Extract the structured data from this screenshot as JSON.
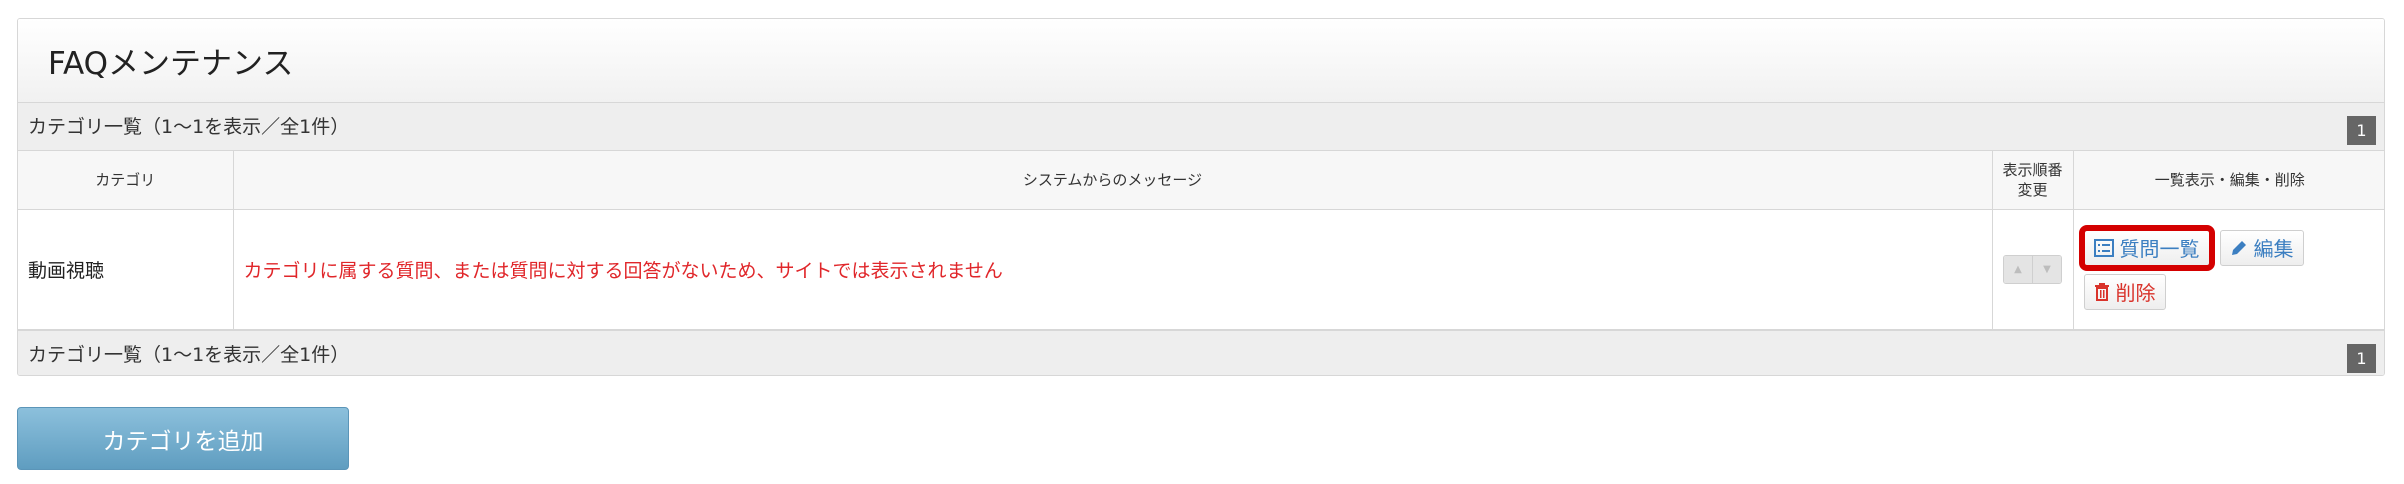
{
  "page": {
    "title": "FAQメンテナンス"
  },
  "pager": {
    "summary_top": "カテゴリ一覧（1〜1を表示／全1件）",
    "summary_bottom": "カテゴリ一覧（1〜1を表示／全1件）",
    "current_page": "1"
  },
  "table": {
    "headers": {
      "category": "カテゴリ",
      "message": "システムからのメッセージ",
      "order_line1": "表示順番",
      "order_line2": "変更",
      "actions": "一覧表示・編集・削除"
    },
    "rows": [
      {
        "category": "動画視聴",
        "message": "カテゴリに属する質問、または質問に対する回答がないため、サイトでは表示されません",
        "order_up": "▲",
        "order_down": "▼",
        "list_label": "質問一覧",
        "edit_label": "編集",
        "delete_label": "削除"
      }
    ]
  },
  "add_button": {
    "label": "カテゴリを追加"
  },
  "colors": {
    "accent": "#3c7fc1",
    "warning_text": "#e0262a",
    "highlight": "#d40000",
    "add_button": "#6fa9c9"
  }
}
